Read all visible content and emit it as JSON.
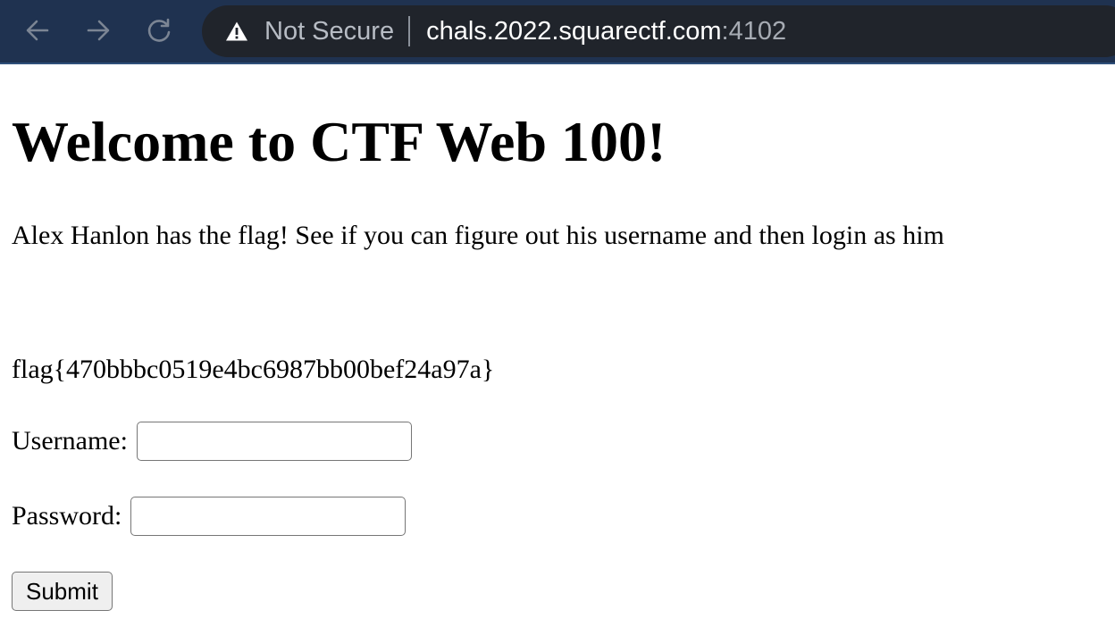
{
  "browser": {
    "security_label": "Not Secure",
    "url_host": "chals.2022.squarectf.com",
    "url_port": ":4102",
    "icons": {
      "back": "arrow-left-icon",
      "forward": "arrow-right-icon",
      "reload": "reload-icon",
      "security": "warning-triangle-icon"
    },
    "colors": {
      "toolbar_bg": "#1f3250",
      "omnibox_bg": "#20242b",
      "nav_icon": "#7b8594"
    }
  },
  "page": {
    "title": "Welcome to CTF Web 100!",
    "intro": "Alex Hanlon has the flag! See if you can figure out his username and then login as him",
    "flag_text": "flag{470bbbc0519e4bc6987bb00bef24a97a}",
    "form": {
      "username_label": "Username:",
      "username_value": "",
      "password_label": "Password:",
      "password_value": "",
      "submit_label": "Submit"
    }
  }
}
